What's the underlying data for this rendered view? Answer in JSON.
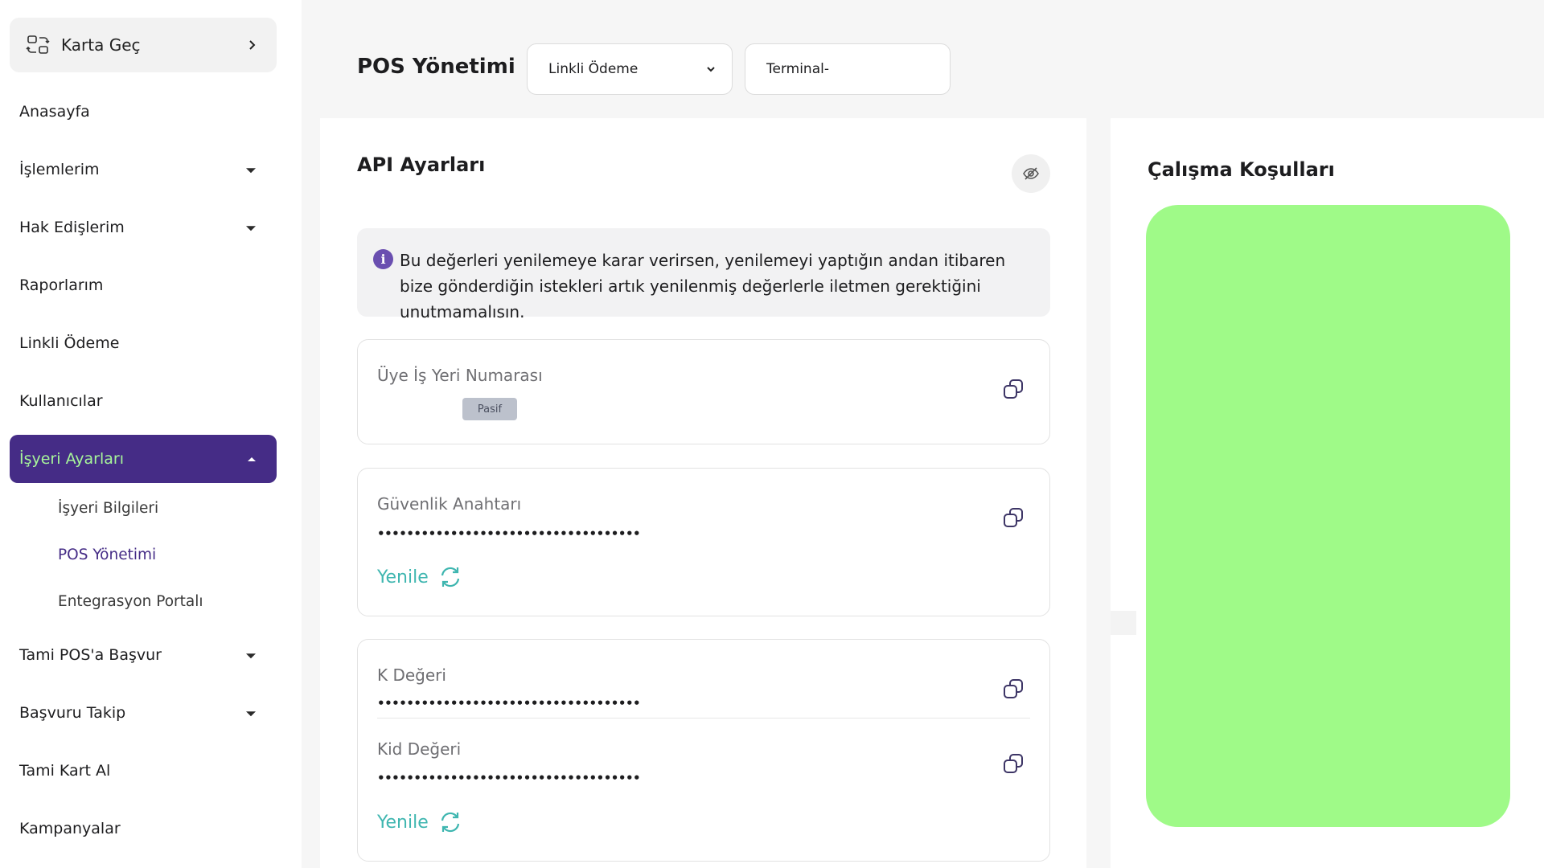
{
  "sidebar": {
    "switch_card": {
      "label": "Karta Geç",
      "icon": "switch-card-icon"
    },
    "items": [
      {
        "label": "Anasayfa",
        "has_caret": false
      },
      {
        "label": "İşlemlerim",
        "has_caret": true
      },
      {
        "label": "Hak Edişlerim",
        "has_caret": true
      },
      {
        "label": "Raporlarım",
        "has_caret": false
      },
      {
        "label": "Linkli Ödeme",
        "has_caret": false
      },
      {
        "label": "Kullanıcılar",
        "has_caret": false
      },
      {
        "label": "İşyeri Ayarları",
        "has_caret": true,
        "active": true
      },
      {
        "label": "Tami POS'a Başvur",
        "has_caret": true
      },
      {
        "label": "Başvuru Takip",
        "has_caret": true
      },
      {
        "label": "Tami Kart Al",
        "has_caret": false
      },
      {
        "label": "Kampanyalar",
        "has_caret": false
      }
    ],
    "sub_items": [
      {
        "label": "İşyeri Bilgileri"
      },
      {
        "label": "POS Yönetimi",
        "current": true
      },
      {
        "label": "Entegrasyon Portalı"
      }
    ]
  },
  "header": {
    "title": "POS Yönetimi",
    "select_value": "Linkli Ödeme",
    "terminal_value": "Terminal-"
  },
  "api": {
    "title": "API Ayarları",
    "info": "Bu değerleri yenilemeye karar verirsen, yenilemeyi yaptığın andan itibaren bize gönderdiğin istekleri artık yenilenmiş değerlerle iletmen gerektiğini unutmamalısın.",
    "merchant": {
      "label": "Üye İş Yeri Numarası",
      "badge": "Pasif"
    },
    "security_key": {
      "label": "Güvenlik Anahtarı",
      "value": "••••••••••••••••••••••••••••••••••••"
    },
    "k_value": {
      "label": "K Değeri",
      "value": "••••••••••••••••••••••••••••••••••••"
    },
    "kid_value": {
      "label": "Kid Değeri",
      "value": "••••••••••••••••••••••••••••••••••••"
    },
    "renew_label": "Yenile"
  },
  "terms": {
    "title": "Çalışma Koşulları"
  },
  "colors": {
    "brand_purple": "#452c86",
    "active_text": "#a7f59a",
    "renew_teal": "#3fb6b0",
    "terms_block": "#9ffa88"
  }
}
